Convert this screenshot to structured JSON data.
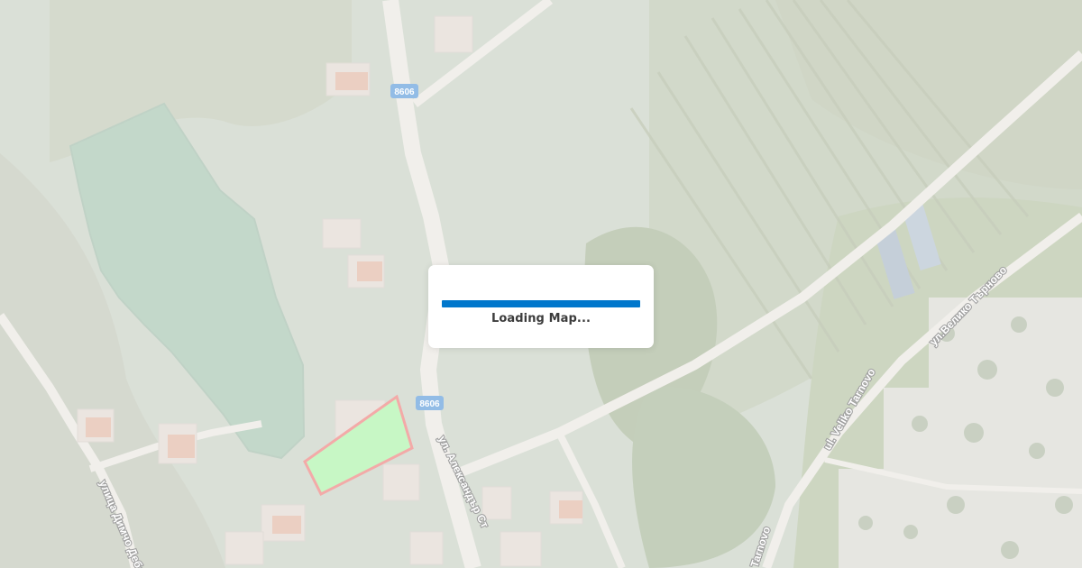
{
  "map": {
    "loading_text": "Loading Map...",
    "progress": 1.0,
    "road_badge": "8606",
    "street_labels": [
      "ул. Александър Ст",
      "ул.Велико Търново",
      "ul. Veliko Tarnovo",
      "улица Димчо Дебе",
      "Tarnovo"
    ]
  },
  "colors": {
    "loader_bar": "#0077cc",
    "highlight_fill": "#95ef91",
    "highlight_stroke": "#e85c59",
    "road_badge_bg": "#2f7fd0",
    "water": "#8db59a"
  }
}
